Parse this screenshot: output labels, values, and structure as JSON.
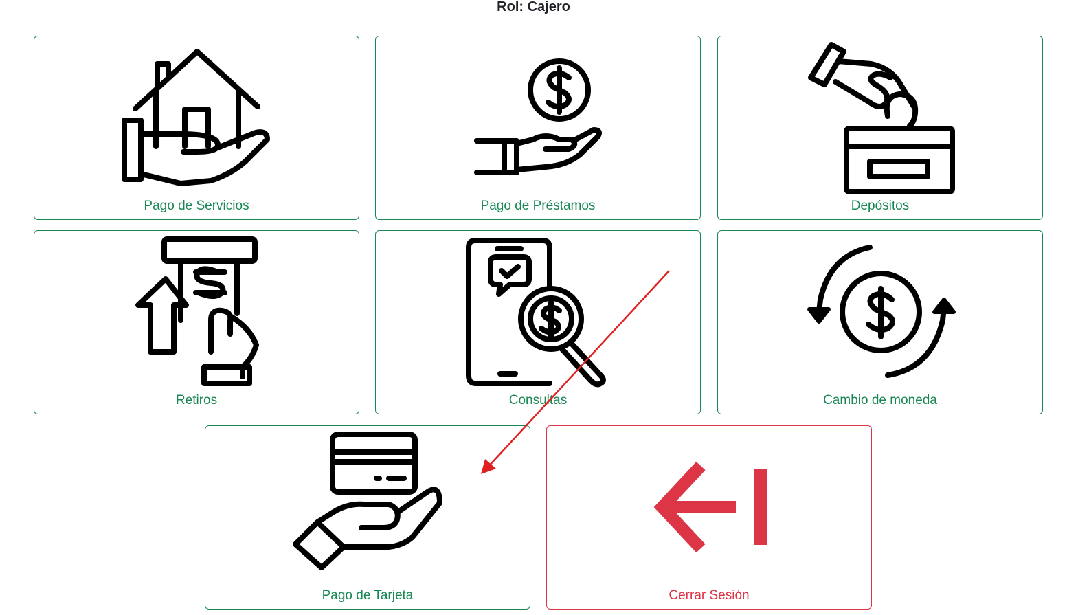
{
  "header": {
    "role": "Rol: Cajero"
  },
  "colors": {
    "success": "#198754",
    "danger": "#dc3545",
    "annotation_arrow": "#e02020"
  },
  "tiles": [
    {
      "label": "Pago de Servicios",
      "icon": "house-in-hand-icon"
    },
    {
      "label": "Pago de Préstamos",
      "icon": "coin-in-hand-icon"
    },
    {
      "label": "Depósitos",
      "icon": "deposit-coin-box-icon"
    },
    {
      "label": "Retiros",
      "icon": "atm-withdraw-icon"
    },
    {
      "label": "Consultas",
      "icon": "phone-search-dollar-icon"
    },
    {
      "label": "Cambio de moneda",
      "icon": "currency-exchange-icon"
    },
    {
      "label": "Pago de Tarjeta",
      "icon": "card-in-hand-icon"
    },
    {
      "label": "Cerrar Sesión",
      "icon": "logout-arrow-icon"
    }
  ]
}
